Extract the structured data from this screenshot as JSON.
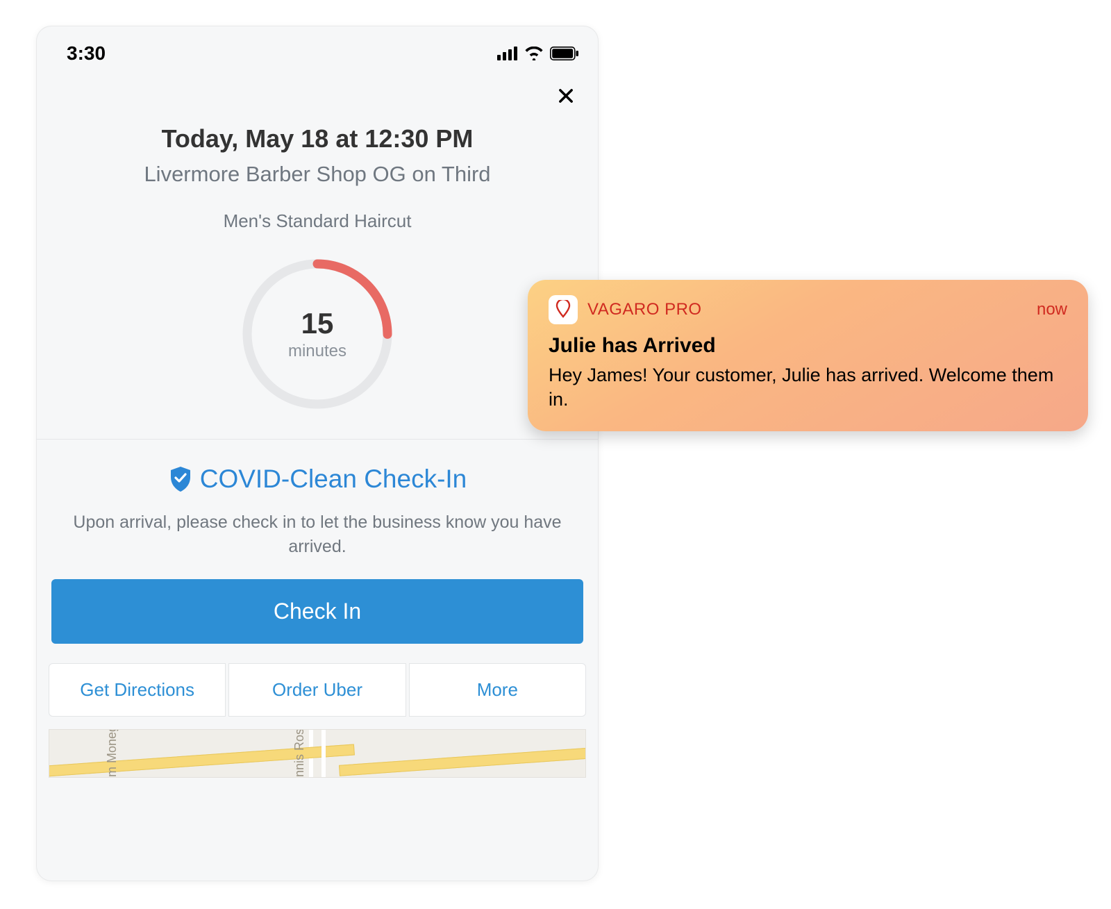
{
  "statusbar": {
    "time": "3:30"
  },
  "appointment": {
    "title": "Today, May 18 at 12:30 PM",
    "location": "Livermore Barber Shop OG on Third",
    "service": "Men's Standard Haircut"
  },
  "countdown": {
    "value": "15",
    "unit": "minutes"
  },
  "covid": {
    "heading": "COVID-Clean Check-In",
    "description": "Upon arrival, please check in to let the business know you have arrived."
  },
  "buttons": {
    "check_in": "Check In",
    "directions": "Get Directions",
    "uber": "Order Uber",
    "more": "More"
  },
  "map": {
    "label1": "m Moneg",
    "label2": "nnis Ros"
  },
  "notification": {
    "app": "VAGARO PRO",
    "time": "now",
    "title": "Julie has Arrived",
    "body": "Hey James! Your customer, Julie has arrived. Welcome them in."
  }
}
